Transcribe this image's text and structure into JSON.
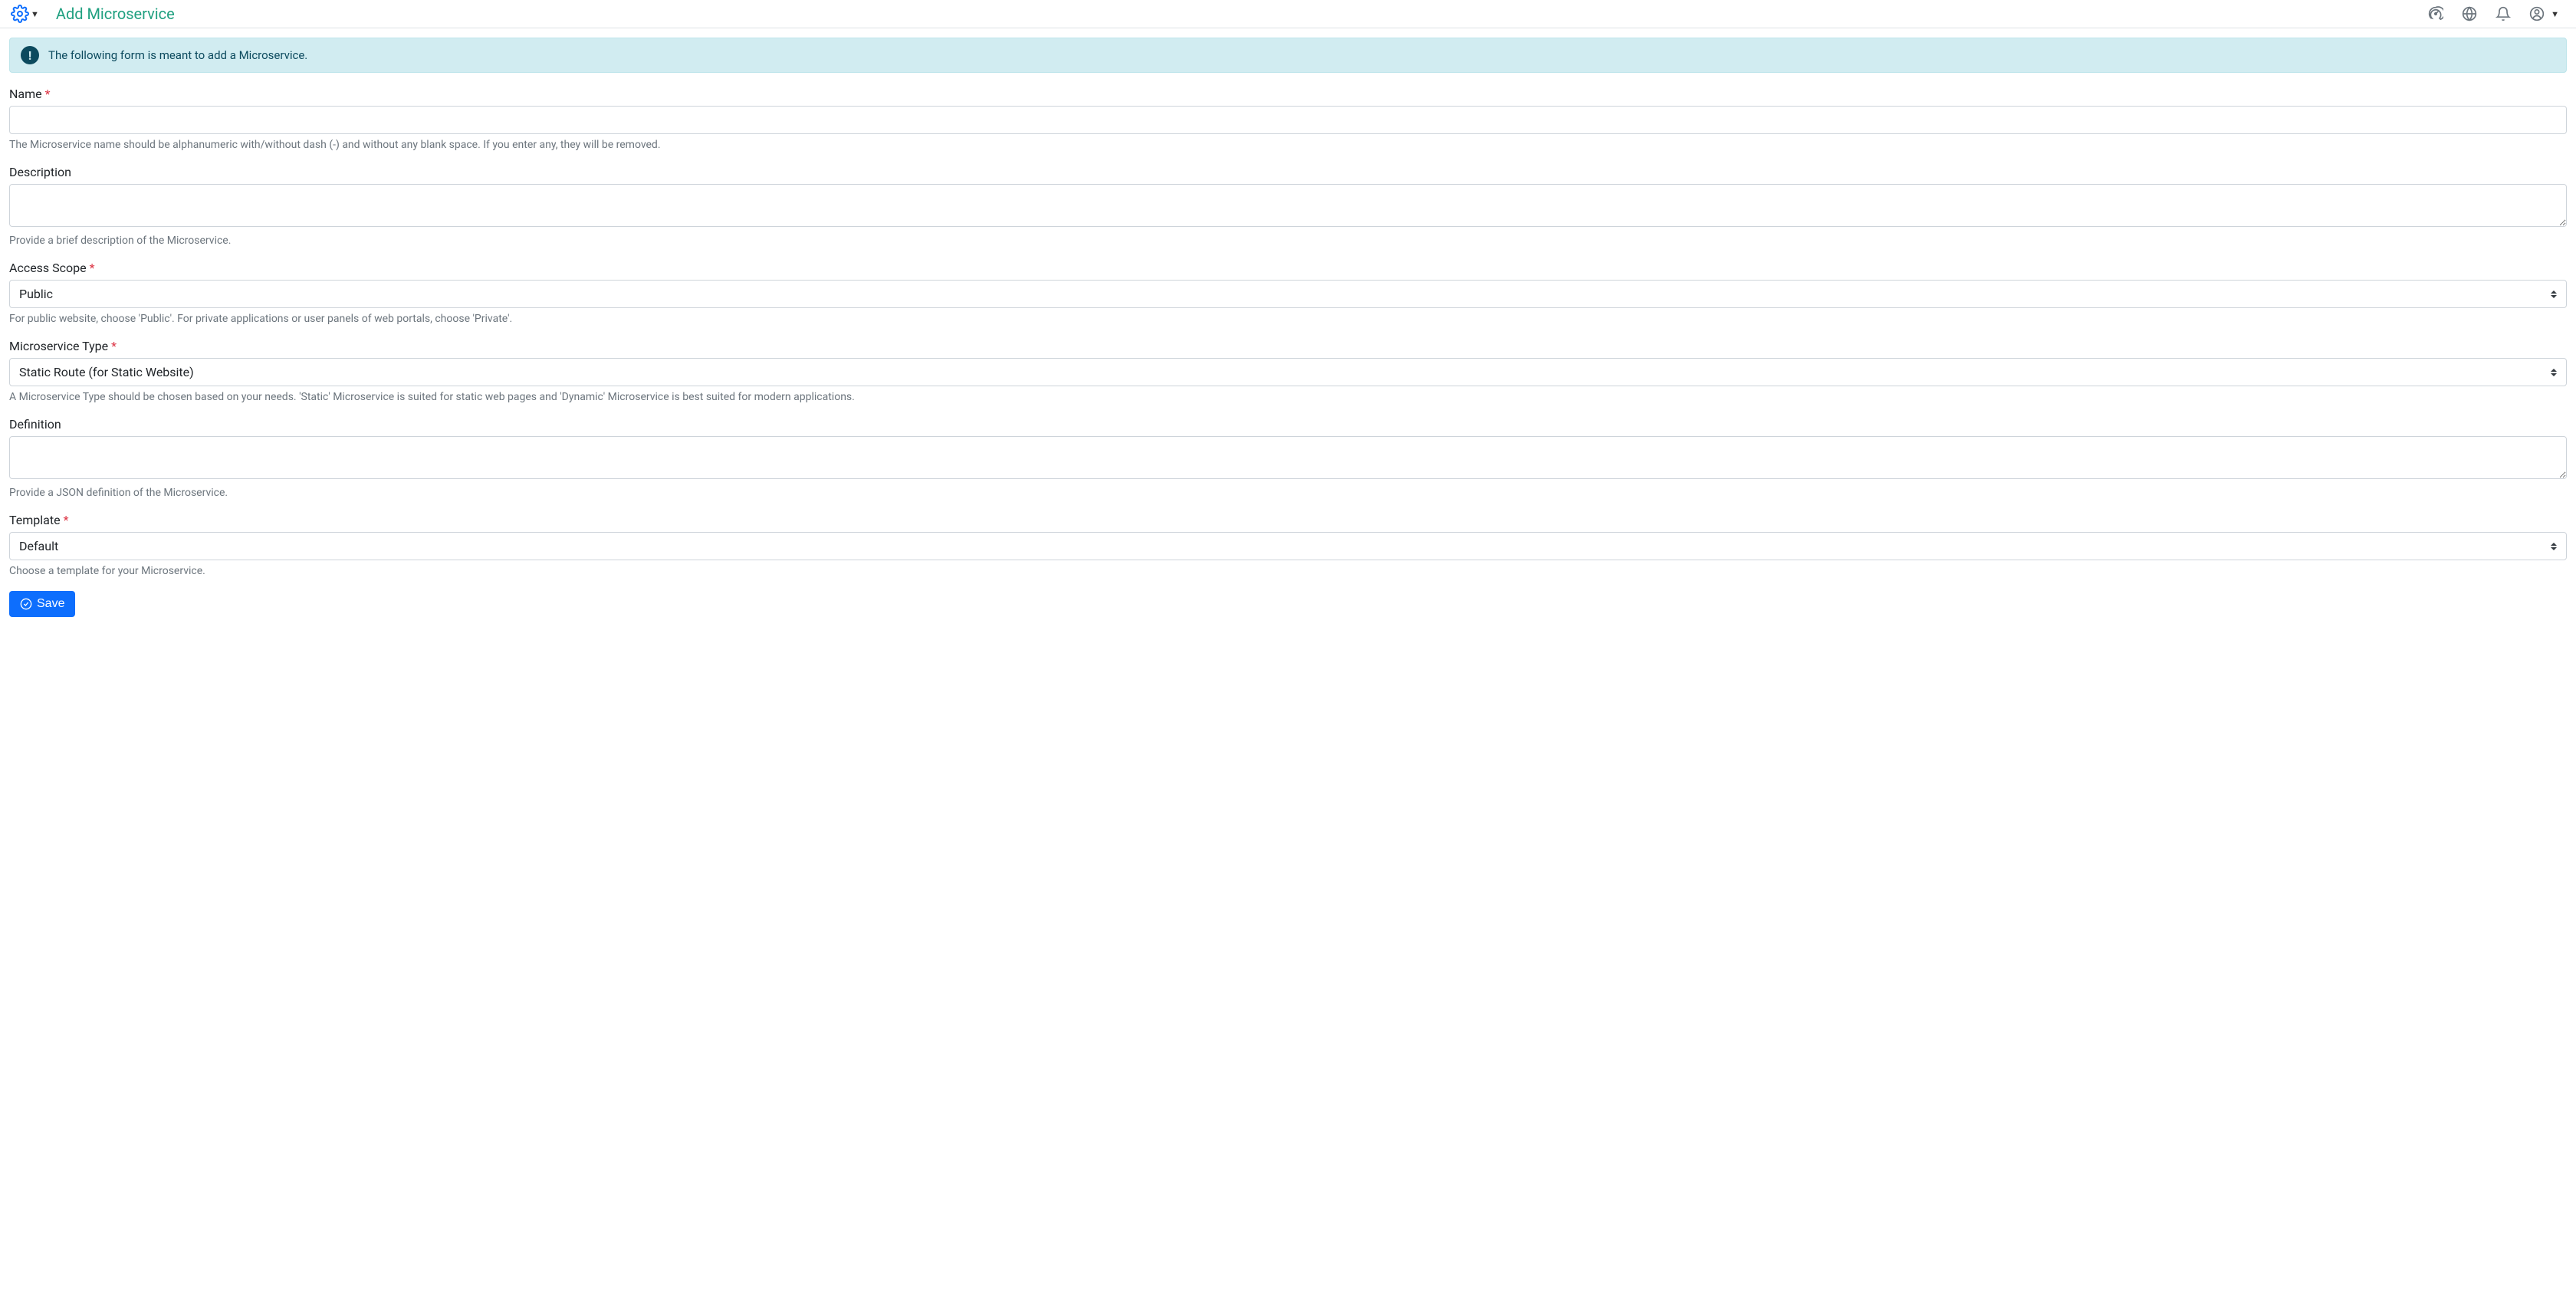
{
  "header": {
    "title": "Add Microservice"
  },
  "info_banner": {
    "text": "The following form is meant to add a Microservice."
  },
  "form": {
    "name": {
      "label": "Name",
      "value": "",
      "help": "The Microservice name should be alphanumeric with/without dash (-) and without any blank space. If you enter any, they will be removed."
    },
    "description": {
      "label": "Description",
      "value": "",
      "help": "Provide a brief description of the Microservice."
    },
    "access_scope": {
      "label": "Access Scope",
      "value": "Public",
      "help": "For public website, choose 'Public'. For private applications or user panels of web portals, choose 'Private'."
    },
    "microservice_type": {
      "label": "Microservice Type",
      "value": "Static Route (for Static Website)",
      "help": "A Microservice Type should be chosen based on your needs. 'Static' Microservice is suited for static web pages and 'Dynamic' Microservice is best suited for modern applications."
    },
    "definition": {
      "label": "Definition",
      "value": "",
      "help": "Provide a JSON definition of the Microservice."
    },
    "template": {
      "label": "Template",
      "value": "Default",
      "help": "Choose a template for your Microservice."
    }
  },
  "buttons": {
    "save": "Save"
  }
}
